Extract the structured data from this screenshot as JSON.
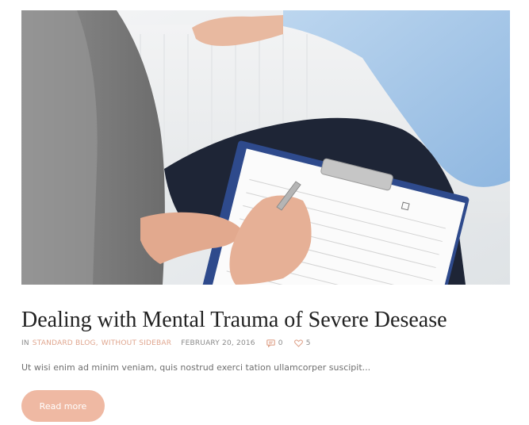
{
  "post": {
    "image_alt": "Therapist taking notes on a clipboard during a session with a patient lying on a couch",
    "title": "Dealing with Mental Trauma of Severe Desease",
    "meta": {
      "in_label": "IN",
      "categories": [
        "STANDARD BLOG",
        "WITHOUT SIDEBAR"
      ],
      "category_separator": ",",
      "date": "FEBRUARY 20, 2016",
      "comments_count": "0",
      "likes_count": "5"
    },
    "excerpt": "Ut wisi enim ad minim veniam, quis nostrud exerci tation ullamcorper suscipit...",
    "read_more_label": "Read more"
  },
  "colors": {
    "accent": "#efb9a3",
    "link": "#e0a68f",
    "title": "#222222",
    "text": "#6f6f6f"
  },
  "icons": {
    "comments": "comment-bubble-icon",
    "likes": "heart-icon"
  }
}
